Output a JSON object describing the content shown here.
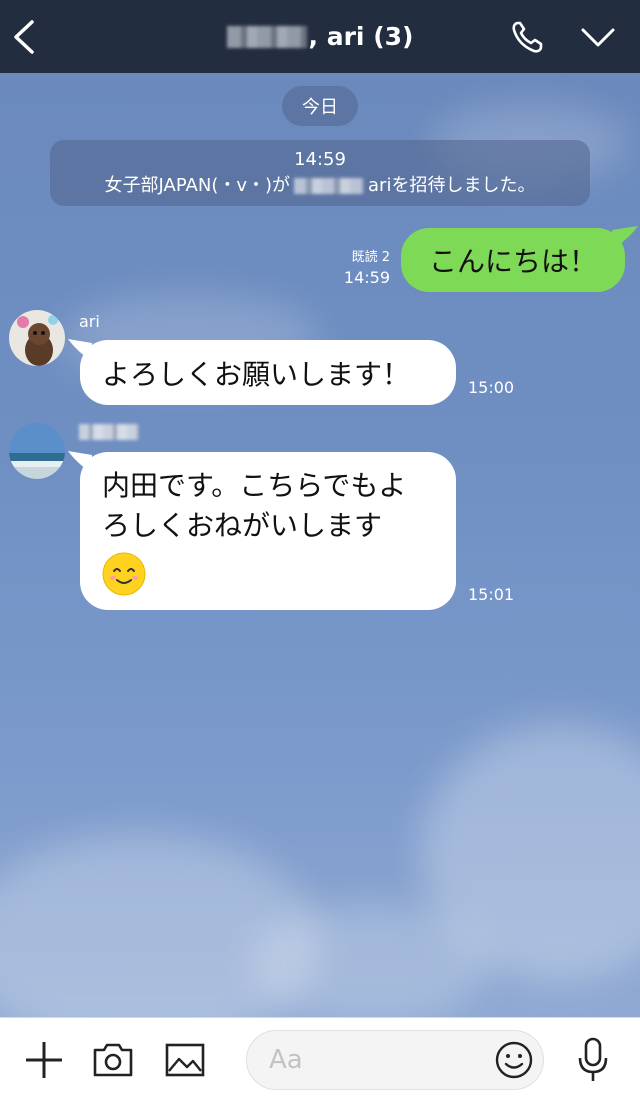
{
  "header": {
    "title": ", ari (3)"
  },
  "chat": {
    "date_label": "今日",
    "system_message": {
      "time": "14:59",
      "prefix": "女子部JAPAN(・v・)が",
      "suffix": "ariを招待しました。"
    },
    "outgoing": {
      "text": "こんにちは！",
      "read_label": "既読 2",
      "time": "14:59"
    },
    "incoming": [
      {
        "name": "ari",
        "text": "よろしくお願いします！",
        "time": "15:00"
      },
      {
        "name": "",
        "line1": "内田です。こちらでもよ",
        "line2": "ろしくおねがいします",
        "time": "15:01"
      }
    ]
  },
  "footer": {
    "input_placeholder": "Aa"
  },
  "colors": {
    "header_bg": "#232d40",
    "outgoing_bubble": "#7ed957",
    "incoming_bubble": "#ffffff"
  }
}
